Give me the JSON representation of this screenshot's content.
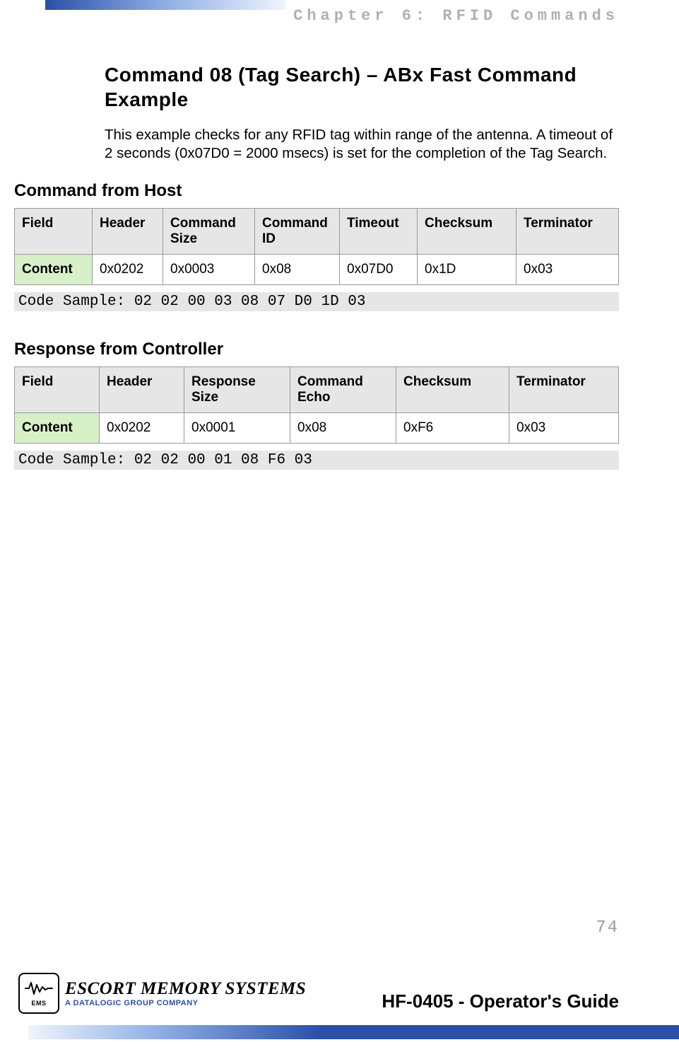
{
  "chapterHeader": "Chapter 6: RFID Commands",
  "sectionTitle": "Command 08 (Tag Search) – ABx Fast Command Example",
  "introText": "This example checks for any RFID tag within range of the antenna. A timeout of 2 seconds (0x07D0 = 2000 msecs) is set for the completion of the Tag Search.",
  "commandFromHost": {
    "heading": "Command from Host",
    "fieldLabel": "Field",
    "contentLabel": "Content",
    "columns": [
      "Header",
      "Command Size",
      "Command ID",
      "Timeout",
      "Checksum",
      "Terminator"
    ],
    "values": [
      "0x0202",
      "0x0003",
      "0x08",
      "0x07D0",
      "0x1D",
      "0x03"
    ],
    "codeSample": "Code Sample: 02 02 00 03 08 07 D0 1D 03"
  },
  "responseFromController": {
    "heading": "Response from Controller",
    "fieldLabel": "Field",
    "contentLabel": "Content",
    "columns": [
      "Header",
      "Response Size",
      "Command Echo",
      "Checksum",
      "Terminator"
    ],
    "values": [
      "0x0202",
      "0x0001",
      "0x08",
      "0xF6",
      "0x03"
    ],
    "codeSample": "Code Sample: 02 02 00 01 08 F6 03"
  },
  "pageNumber": "74",
  "footer": {
    "company": "ESCORT MEMORY SYSTEMS",
    "tagline": "A DATALOGIC GROUP COMPANY",
    "guide": "HF-0405 - Operator's Guide",
    "logoAbbrev": "EMS"
  }
}
